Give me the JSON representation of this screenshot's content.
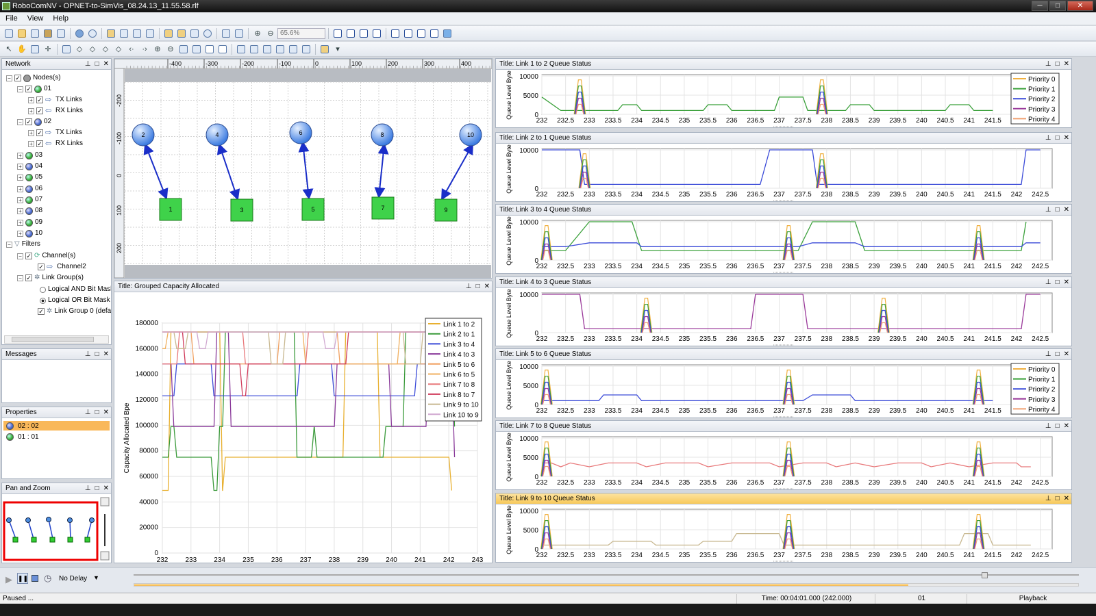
{
  "window": {
    "title": "RoboComNV - OPNET-to-SimVis_08.24.13_11.55.58.rlf"
  },
  "menu": [
    "File",
    "View",
    "Help"
  ],
  "toolbar": {
    "zoom": "65.6%"
  },
  "network_panel": {
    "title": "Network",
    "tree": [
      {
        "label": "Nodes(s)",
        "icon": "gray-ball-icon"
      },
      {
        "label": "01",
        "icon": "green-ball-icon"
      },
      {
        "label": "TX Links",
        "icon": "tx-arrow-icon"
      },
      {
        "label": "RX Links",
        "icon": "rx-arrow-icon"
      },
      {
        "label": "02",
        "icon": "blue-ball-icon"
      },
      {
        "label": "TX Links",
        "icon": "tx-arrow-icon"
      },
      {
        "label": "RX Links",
        "icon": "rx-arrow-icon"
      },
      {
        "label": "03",
        "icon": "green-ball-icon"
      },
      {
        "label": "04",
        "icon": "blue-ball-icon"
      },
      {
        "label": "05",
        "icon": "green-ball-icon"
      },
      {
        "label": "06",
        "icon": "blue-ball-icon"
      },
      {
        "label": "07",
        "icon": "green-ball-icon"
      },
      {
        "label": "08",
        "icon": "blue-ball-icon"
      },
      {
        "label": "09",
        "icon": "green-ball-icon"
      },
      {
        "label": "10",
        "icon": "blue-ball-icon"
      },
      {
        "label": "Filters",
        "icon": "funnel-icon"
      },
      {
        "label": "Channel(s)",
        "icon": "channel-icon"
      },
      {
        "label": "Channel2",
        "icon": "arrow-icon"
      },
      {
        "label": "Link Group(s)",
        "icon": "link-group-icon"
      },
      {
        "label": "Logical AND Bit Mask",
        "icon": "radio-off"
      },
      {
        "label": "Logical OR Bit Mask",
        "icon": "radio-on"
      },
      {
        "label": "Link Group 0 (defa",
        "icon": "link-group-icon"
      }
    ]
  },
  "messages_panel": {
    "title": "Messages"
  },
  "properties_panel": {
    "title": "Properties",
    "rows": [
      "02 : 02",
      "01 : 01"
    ]
  },
  "panzoom_panel": {
    "title": "Pan and Zoom"
  },
  "topology": {
    "ruler_ticks": [
      "-400",
      "-300",
      "-200",
      "-100",
      "0",
      "100",
      "200",
      "300",
      "400"
    ],
    "vruler_ticks": [
      "-200",
      "-100",
      "0",
      "100",
      "200"
    ],
    "blue_nodes": [
      "2",
      "4",
      "6",
      "8",
      "10"
    ],
    "green_nodes": [
      "1",
      "3",
      "5",
      "7",
      "9"
    ]
  },
  "capacity_chart": {
    "header": "Title: Grouped Capacity Allocated"
  },
  "chart_data": [
    {
      "type": "line",
      "title": "Title: Grouped Capacity Allocated",
      "ylabel": "Capacity Allocated Bpe",
      "xlim": [
        232,
        243
      ],
      "ylim": [
        0,
        180000
      ],
      "x_ticks": [
        "232",
        "233",
        "234",
        "235",
        "236",
        "237",
        "238",
        "239",
        "240",
        "241",
        "242",
        "243"
      ],
      "y_ticks": [
        "0",
        "20000",
        "40000",
        "60000",
        "80000",
        "100000",
        "120000",
        "140000",
        "160000",
        "180000"
      ],
      "legend": "top-right",
      "series": [
        {
          "name": "Link 1 to 2",
          "color": "#e8b030"
        },
        {
          "name": "Link 2 to 1",
          "color": "#3a9a3a"
        },
        {
          "name": "Link 3 to 4",
          "color": "#3a4ad8"
        },
        {
          "name": "Link 4 to 3",
          "color": "#8a3a9a"
        },
        {
          "name": "Link 5 to 6",
          "color": "#f0a060"
        },
        {
          "name": "Link 6 to 5",
          "color": "#f0b060"
        },
        {
          "name": "Link 7 to 8",
          "color": "#e8787a"
        },
        {
          "name": "Link 8 to 7",
          "color": "#d03a5a"
        },
        {
          "name": "Link 9 to 10",
          "color": "#c8b890"
        },
        {
          "name": "Link 10 to 9",
          "color": "#d0a8d0"
        }
      ]
    }
  ],
  "queue_charts": [
    {
      "title": "Title: Link 1 to 2 Queue Status",
      "ylabel": "Queue Level Byte",
      "yticks": [
        "10000",
        "5000",
        "0"
      ],
      "x_ticks": [
        "232",
        "232.5",
        "233",
        "233.5",
        "234",
        "234.5",
        "235",
        "235.5",
        "236",
        "236.5",
        "237",
        "237.5",
        "238",
        "238.5",
        "239",
        "239.5",
        "240",
        "240.5",
        "241",
        "241.5"
      ],
      "legend": [
        "Priority 0",
        "Priority 1",
        "Priority 2",
        "Priority 3",
        "Priority 4"
      ]
    },
    {
      "title": "Title: Link 2 to 1 Queue Status",
      "ylabel": "Queue Level Byte",
      "yticks": [
        "10000",
        "0"
      ],
      "x_ticks": [
        "232",
        "232.5",
        "233",
        "233.5",
        "234",
        "234.5",
        "235",
        "235.5",
        "236",
        "236.5",
        "237",
        "237.5",
        "238",
        "238.5",
        "239",
        "239.5",
        "240",
        "240.5",
        "241",
        "241.5",
        "242",
        "242.5"
      ],
      "legend": []
    },
    {
      "title": "Title: Link 3 to 4 Queue Status",
      "ylabel": "Queue Level Byte",
      "yticks": [
        "10000",
        "0"
      ],
      "x_ticks": [
        "232",
        "232.5",
        "233",
        "233.5",
        "234",
        "234.5",
        "235",
        "235.5",
        "236",
        "236.5",
        "237",
        "237.5",
        "238",
        "238.5",
        "239",
        "239.5",
        "240",
        "240.5",
        "241",
        "241.5",
        "242",
        "242.5"
      ],
      "legend": []
    },
    {
      "title": "Title: Link 4 to 3 Queue Status",
      "ylabel": "Queue Level Byte",
      "yticks": [
        "10000",
        "0"
      ],
      "x_ticks": [
        "232",
        "232.5",
        "233",
        "233.5",
        "234",
        "234.5",
        "235",
        "235.5",
        "236",
        "236.5",
        "237",
        "237.5",
        "238",
        "238.5",
        "239",
        "239.5",
        "240",
        "240.5",
        "241",
        "241.5",
        "242",
        "242.5"
      ],
      "legend": []
    },
    {
      "title": "Title: Link 5 to 6 Queue Status",
      "ylabel": "Queue Level Byte",
      "yticks": [
        "10000",
        "5000",
        "0"
      ],
      "x_ticks": [
        "232",
        "232.5",
        "233",
        "233.5",
        "234",
        "234.5",
        "235",
        "235.5",
        "236",
        "236.5",
        "237",
        "237.5",
        "238",
        "238.5",
        "239",
        "239.5",
        "240",
        "240.5",
        "241",
        "241.5"
      ],
      "legend": [
        "Priority 0",
        "Priority 1",
        "Priority 2",
        "Priority 3",
        "Priority 4"
      ]
    },
    {
      "title": "Title: Link 7 to 8 Queue Status",
      "ylabel": "Queue Level Byte",
      "yticks": [
        "10000",
        "5000",
        "0"
      ],
      "x_ticks": [
        "232",
        "232.5",
        "233",
        "233.5",
        "234",
        "234.5",
        "235",
        "235.5",
        "236",
        "236.5",
        "237",
        "237.5",
        "238",
        "238.5",
        "239",
        "239.5",
        "240",
        "240.5",
        "241",
        "241.5",
        "242",
        "242.5"
      ],
      "legend": []
    },
    {
      "title": "Title: Link 9 to 10 Queue Status",
      "ylabel": "Queue Level Byte",
      "yticks": [
        "10000",
        "5000",
        "0"
      ],
      "x_ticks": [
        "232",
        "232.5",
        "233",
        "233.5",
        "234",
        "234.5",
        "235",
        "235.5",
        "236",
        "236.5",
        "237",
        "237.5",
        "238",
        "238.5",
        "239",
        "239.5",
        "240",
        "240.5",
        "241",
        "241.5",
        "242",
        "242.5"
      ],
      "legend": []
    }
  ],
  "playback": {
    "delay": "No Delay",
    "progress": 0.82
  },
  "status": {
    "state": "Paused ...",
    "time": "Time: 00:04:01.000  (242.000)",
    "node": "01",
    "mode": "Playback"
  },
  "colors": {
    "accent": "#f8c95a",
    "selection": "#f9b85a"
  }
}
